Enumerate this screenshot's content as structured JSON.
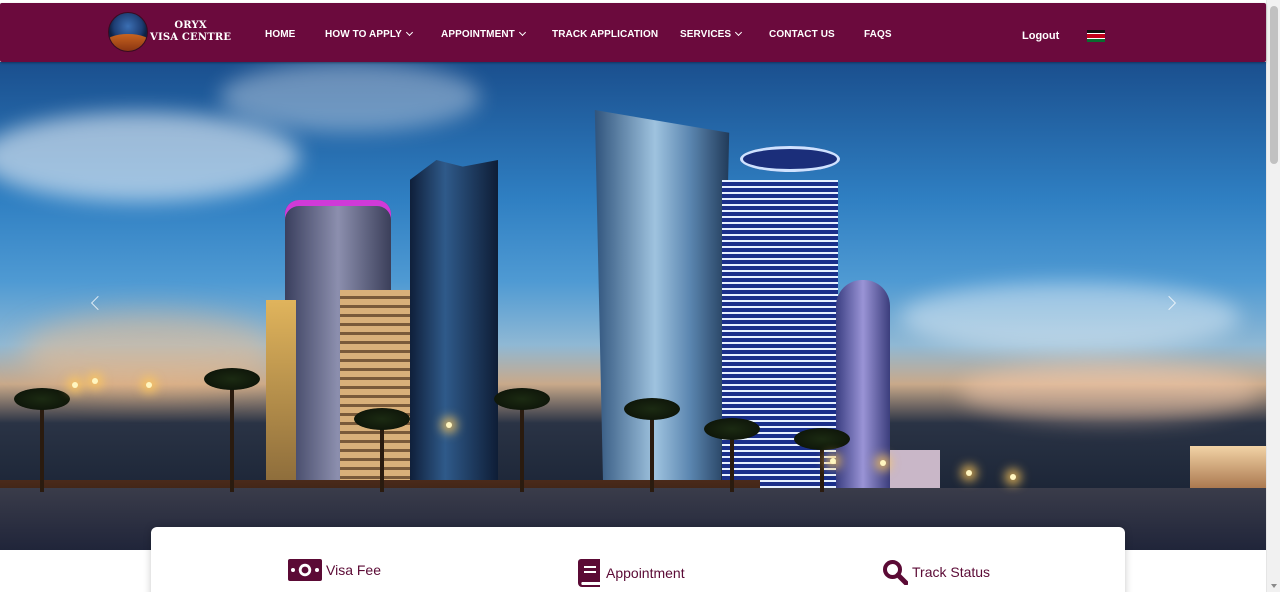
{
  "brand": {
    "name_line1": "ORYX",
    "name_line2": "VISA CENTRE"
  },
  "nav": {
    "items": [
      {
        "label": "HOME",
        "has_dropdown": false
      },
      {
        "label": "HOW TO APPLY",
        "has_dropdown": true
      },
      {
        "label": "APPOINTMENT",
        "has_dropdown": true
      },
      {
        "label": "TRACK APPLICATION",
        "has_dropdown": false
      },
      {
        "label": "SERVICES",
        "has_dropdown": true
      },
      {
        "label": "CONTACT US",
        "has_dropdown": false
      },
      {
        "label": "FAQS",
        "has_dropdown": false
      }
    ],
    "logout_label": "Logout",
    "flag_icon": "kenya-flag-icon"
  },
  "hero": {
    "prev_icon": "chevron-left-icon",
    "next_icon": "chevron-right-icon"
  },
  "quick_links": [
    {
      "label": "Visa Fee",
      "icon": "money-icon"
    },
    {
      "label": "Appointment",
      "icon": "book-icon"
    },
    {
      "label": "Track Status",
      "icon": "search-icon"
    }
  ],
  "colors": {
    "primary": "#6b0a3d",
    "accent_text": "#5b0a35"
  }
}
